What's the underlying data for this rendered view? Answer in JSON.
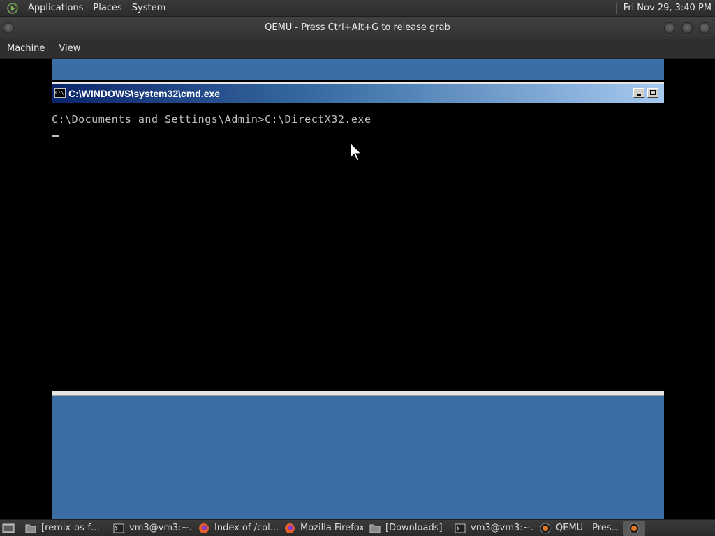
{
  "top_panel": {
    "menus": [
      "Applications",
      "Places",
      "System"
    ],
    "clock": "Fri Nov 29,  3:40 PM"
  },
  "qemu_window": {
    "title": "QEMU - Press Ctrl+Alt+G to release grab",
    "menus": [
      "Machine",
      "View"
    ]
  },
  "guest": {
    "cmd_window": {
      "title": "C:\\WINDOWS\\system32\\cmd.exe",
      "icon_text": "C:\\.",
      "prompt_line": "C:\\Documents and Settings\\Admin>C:\\DirectX32.exe"
    },
    "colors": {
      "desktop": "#3b6ea5",
      "titlebar_start": "#0a246a",
      "titlebar_end": "#a6caf0"
    }
  },
  "taskbar": {
    "items": [
      {
        "label": "[remix-os-f…",
        "icon": "folder-icon",
        "active": false
      },
      {
        "label": "vm3@vm3:~…",
        "icon": "terminal-icon",
        "active": false
      },
      {
        "label": "Index of /col…",
        "icon": "firefox-icon",
        "active": false
      },
      {
        "label": "Mozilla Firefox",
        "icon": "firefox-icon",
        "active": false
      },
      {
        "label": "[Downloads]",
        "icon": "folder-icon",
        "active": false
      },
      {
        "label": "vm3@vm3:~…",
        "icon": "terminal-icon",
        "active": false
      },
      {
        "label": "QEMU - Pres…",
        "icon": "qemu-icon",
        "active": false
      },
      {
        "label": "",
        "icon": "qemu-icon",
        "active": true
      }
    ]
  }
}
